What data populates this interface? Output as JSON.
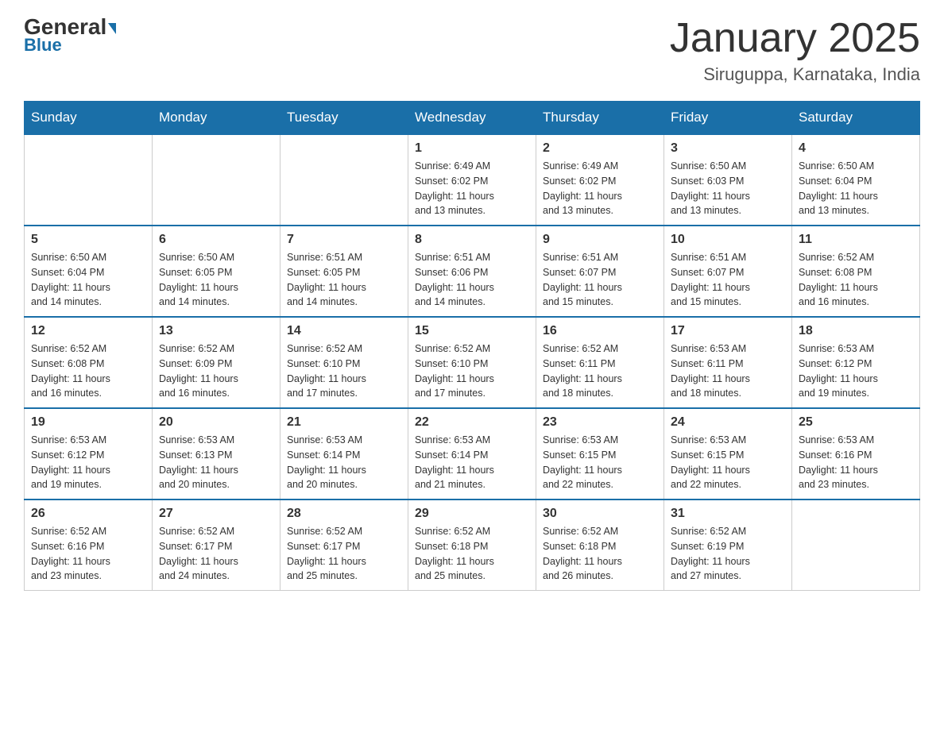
{
  "header": {
    "logo_general": "General",
    "logo_blue": "Blue",
    "month_title": "January 2025",
    "location": "Siruguppa, Karnataka, India"
  },
  "days_of_week": [
    "Sunday",
    "Monday",
    "Tuesday",
    "Wednesday",
    "Thursday",
    "Friday",
    "Saturday"
  ],
  "weeks": [
    [
      {
        "day": "",
        "info": ""
      },
      {
        "day": "",
        "info": ""
      },
      {
        "day": "",
        "info": ""
      },
      {
        "day": "1",
        "info": "Sunrise: 6:49 AM\nSunset: 6:02 PM\nDaylight: 11 hours\nand 13 minutes."
      },
      {
        "day": "2",
        "info": "Sunrise: 6:49 AM\nSunset: 6:02 PM\nDaylight: 11 hours\nand 13 minutes."
      },
      {
        "day": "3",
        "info": "Sunrise: 6:50 AM\nSunset: 6:03 PM\nDaylight: 11 hours\nand 13 minutes."
      },
      {
        "day": "4",
        "info": "Sunrise: 6:50 AM\nSunset: 6:04 PM\nDaylight: 11 hours\nand 13 minutes."
      }
    ],
    [
      {
        "day": "5",
        "info": "Sunrise: 6:50 AM\nSunset: 6:04 PM\nDaylight: 11 hours\nand 14 minutes."
      },
      {
        "day": "6",
        "info": "Sunrise: 6:50 AM\nSunset: 6:05 PM\nDaylight: 11 hours\nand 14 minutes."
      },
      {
        "day": "7",
        "info": "Sunrise: 6:51 AM\nSunset: 6:05 PM\nDaylight: 11 hours\nand 14 minutes."
      },
      {
        "day": "8",
        "info": "Sunrise: 6:51 AM\nSunset: 6:06 PM\nDaylight: 11 hours\nand 14 minutes."
      },
      {
        "day": "9",
        "info": "Sunrise: 6:51 AM\nSunset: 6:07 PM\nDaylight: 11 hours\nand 15 minutes."
      },
      {
        "day": "10",
        "info": "Sunrise: 6:51 AM\nSunset: 6:07 PM\nDaylight: 11 hours\nand 15 minutes."
      },
      {
        "day": "11",
        "info": "Sunrise: 6:52 AM\nSunset: 6:08 PM\nDaylight: 11 hours\nand 16 minutes."
      }
    ],
    [
      {
        "day": "12",
        "info": "Sunrise: 6:52 AM\nSunset: 6:08 PM\nDaylight: 11 hours\nand 16 minutes."
      },
      {
        "day": "13",
        "info": "Sunrise: 6:52 AM\nSunset: 6:09 PM\nDaylight: 11 hours\nand 16 minutes."
      },
      {
        "day": "14",
        "info": "Sunrise: 6:52 AM\nSunset: 6:10 PM\nDaylight: 11 hours\nand 17 minutes."
      },
      {
        "day": "15",
        "info": "Sunrise: 6:52 AM\nSunset: 6:10 PM\nDaylight: 11 hours\nand 17 minutes."
      },
      {
        "day": "16",
        "info": "Sunrise: 6:52 AM\nSunset: 6:11 PM\nDaylight: 11 hours\nand 18 minutes."
      },
      {
        "day": "17",
        "info": "Sunrise: 6:53 AM\nSunset: 6:11 PM\nDaylight: 11 hours\nand 18 minutes."
      },
      {
        "day": "18",
        "info": "Sunrise: 6:53 AM\nSunset: 6:12 PM\nDaylight: 11 hours\nand 19 minutes."
      }
    ],
    [
      {
        "day": "19",
        "info": "Sunrise: 6:53 AM\nSunset: 6:12 PM\nDaylight: 11 hours\nand 19 minutes."
      },
      {
        "day": "20",
        "info": "Sunrise: 6:53 AM\nSunset: 6:13 PM\nDaylight: 11 hours\nand 20 minutes."
      },
      {
        "day": "21",
        "info": "Sunrise: 6:53 AM\nSunset: 6:14 PM\nDaylight: 11 hours\nand 20 minutes."
      },
      {
        "day": "22",
        "info": "Sunrise: 6:53 AM\nSunset: 6:14 PM\nDaylight: 11 hours\nand 21 minutes."
      },
      {
        "day": "23",
        "info": "Sunrise: 6:53 AM\nSunset: 6:15 PM\nDaylight: 11 hours\nand 22 minutes."
      },
      {
        "day": "24",
        "info": "Sunrise: 6:53 AM\nSunset: 6:15 PM\nDaylight: 11 hours\nand 22 minutes."
      },
      {
        "day": "25",
        "info": "Sunrise: 6:53 AM\nSunset: 6:16 PM\nDaylight: 11 hours\nand 23 minutes."
      }
    ],
    [
      {
        "day": "26",
        "info": "Sunrise: 6:52 AM\nSunset: 6:16 PM\nDaylight: 11 hours\nand 23 minutes."
      },
      {
        "day": "27",
        "info": "Sunrise: 6:52 AM\nSunset: 6:17 PM\nDaylight: 11 hours\nand 24 minutes."
      },
      {
        "day": "28",
        "info": "Sunrise: 6:52 AM\nSunset: 6:17 PM\nDaylight: 11 hours\nand 25 minutes."
      },
      {
        "day": "29",
        "info": "Sunrise: 6:52 AM\nSunset: 6:18 PM\nDaylight: 11 hours\nand 25 minutes."
      },
      {
        "day": "30",
        "info": "Sunrise: 6:52 AM\nSunset: 6:18 PM\nDaylight: 11 hours\nand 26 minutes."
      },
      {
        "day": "31",
        "info": "Sunrise: 6:52 AM\nSunset: 6:19 PM\nDaylight: 11 hours\nand 27 minutes."
      },
      {
        "day": "",
        "info": ""
      }
    ]
  ]
}
